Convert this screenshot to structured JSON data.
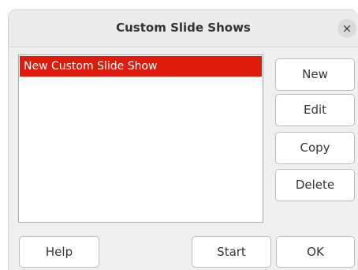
{
  "dialog": {
    "title": "Custom Slide Shows",
    "close_label": "×"
  },
  "list": {
    "items": [
      {
        "label": "New Custom Slide Show",
        "selected": true
      }
    ],
    "selection_color": "#e01b0b"
  },
  "side_buttons": {
    "new": "New",
    "edit": "Edit",
    "copy": "Copy",
    "delete": "Delete"
  },
  "footer": {
    "help": "Help",
    "start": "Start",
    "ok": "OK"
  }
}
